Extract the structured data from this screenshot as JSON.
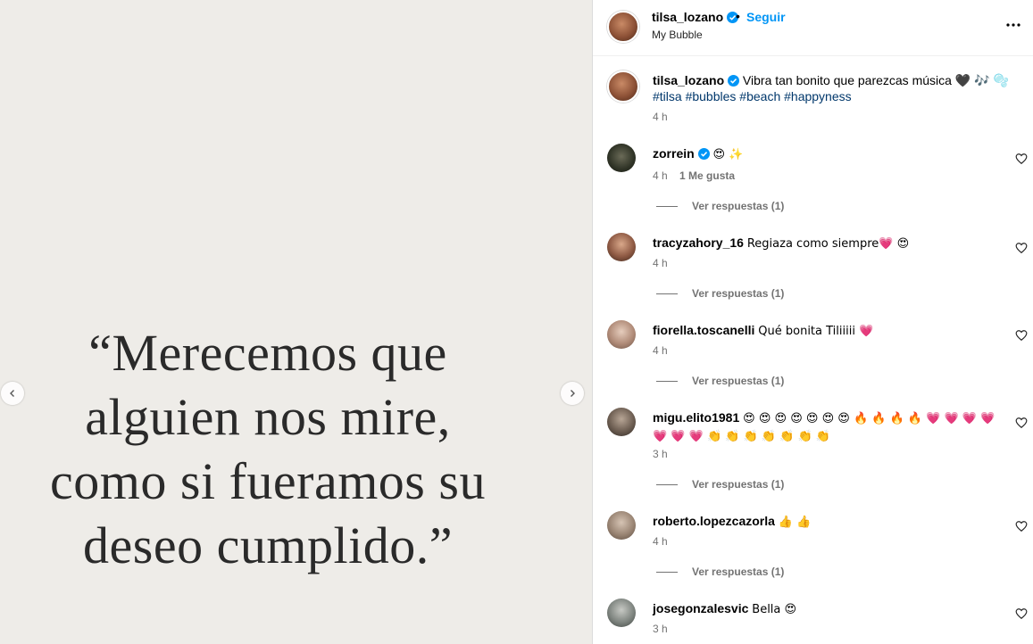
{
  "post": {
    "quote_lines": [
      "“Merecemos que",
      "alguien nos mire,",
      "como si fueramos su",
      "deseo cumplido.”"
    ]
  },
  "header": {
    "username": "tilsa_lozano",
    "separator": "•",
    "follow_label": "Seguir",
    "subtitle": "My Bubble"
  },
  "caption": {
    "username": "tilsa_lozano",
    "text": "Vibra tan bonito que parezcas música 🖤 🎶 🫧",
    "hashtags": [
      "#tilsa",
      "#bubbles",
      "#beach",
      "#happyness"
    ],
    "time": "4 h"
  },
  "comments": [
    {
      "username": "zorrein",
      "verified": true,
      "text": "😍 ✨",
      "time": "4 h",
      "likes": "1 Me gusta",
      "replies": "Ver respuestas (1)"
    },
    {
      "username": "tracyzahory_16",
      "text": "Regiaza como siempre💗 😍",
      "time": "4 h",
      "replies": "Ver respuestas (1)"
    },
    {
      "username": "fiorella.toscanelli",
      "text": "Qué bonita Tiliiiii 💗",
      "time": "4 h",
      "replies": "Ver respuestas (1)"
    },
    {
      "username": "migu.elito1981",
      "text": "😍 😍 😍 😍 😍 😍 😍 🔥 🔥 🔥 🔥 💗 💗 💗 💗 💗 💗 💗 👏 👏 👏 👏 👏 👏 👏",
      "time": "3 h",
      "replies": "Ver respuestas (1)"
    },
    {
      "username": "roberto.lopezcazorla",
      "text": "👍 👍",
      "time": "4 h",
      "replies": "Ver respuestas (1)"
    },
    {
      "username": "josegonzalesvic",
      "text": "Bella 😍",
      "time": "3 h"
    }
  ],
  "colors": {
    "link_blue": "#0095f6",
    "hashtag": "#00376b",
    "meta_gray": "#737373",
    "verified": "#0095f6",
    "media_bg": "#eeece8"
  },
  "icons": [
    "chevron-left-icon",
    "chevron-right-icon",
    "more-icon",
    "verified-icon",
    "heart-outline-icon"
  ]
}
